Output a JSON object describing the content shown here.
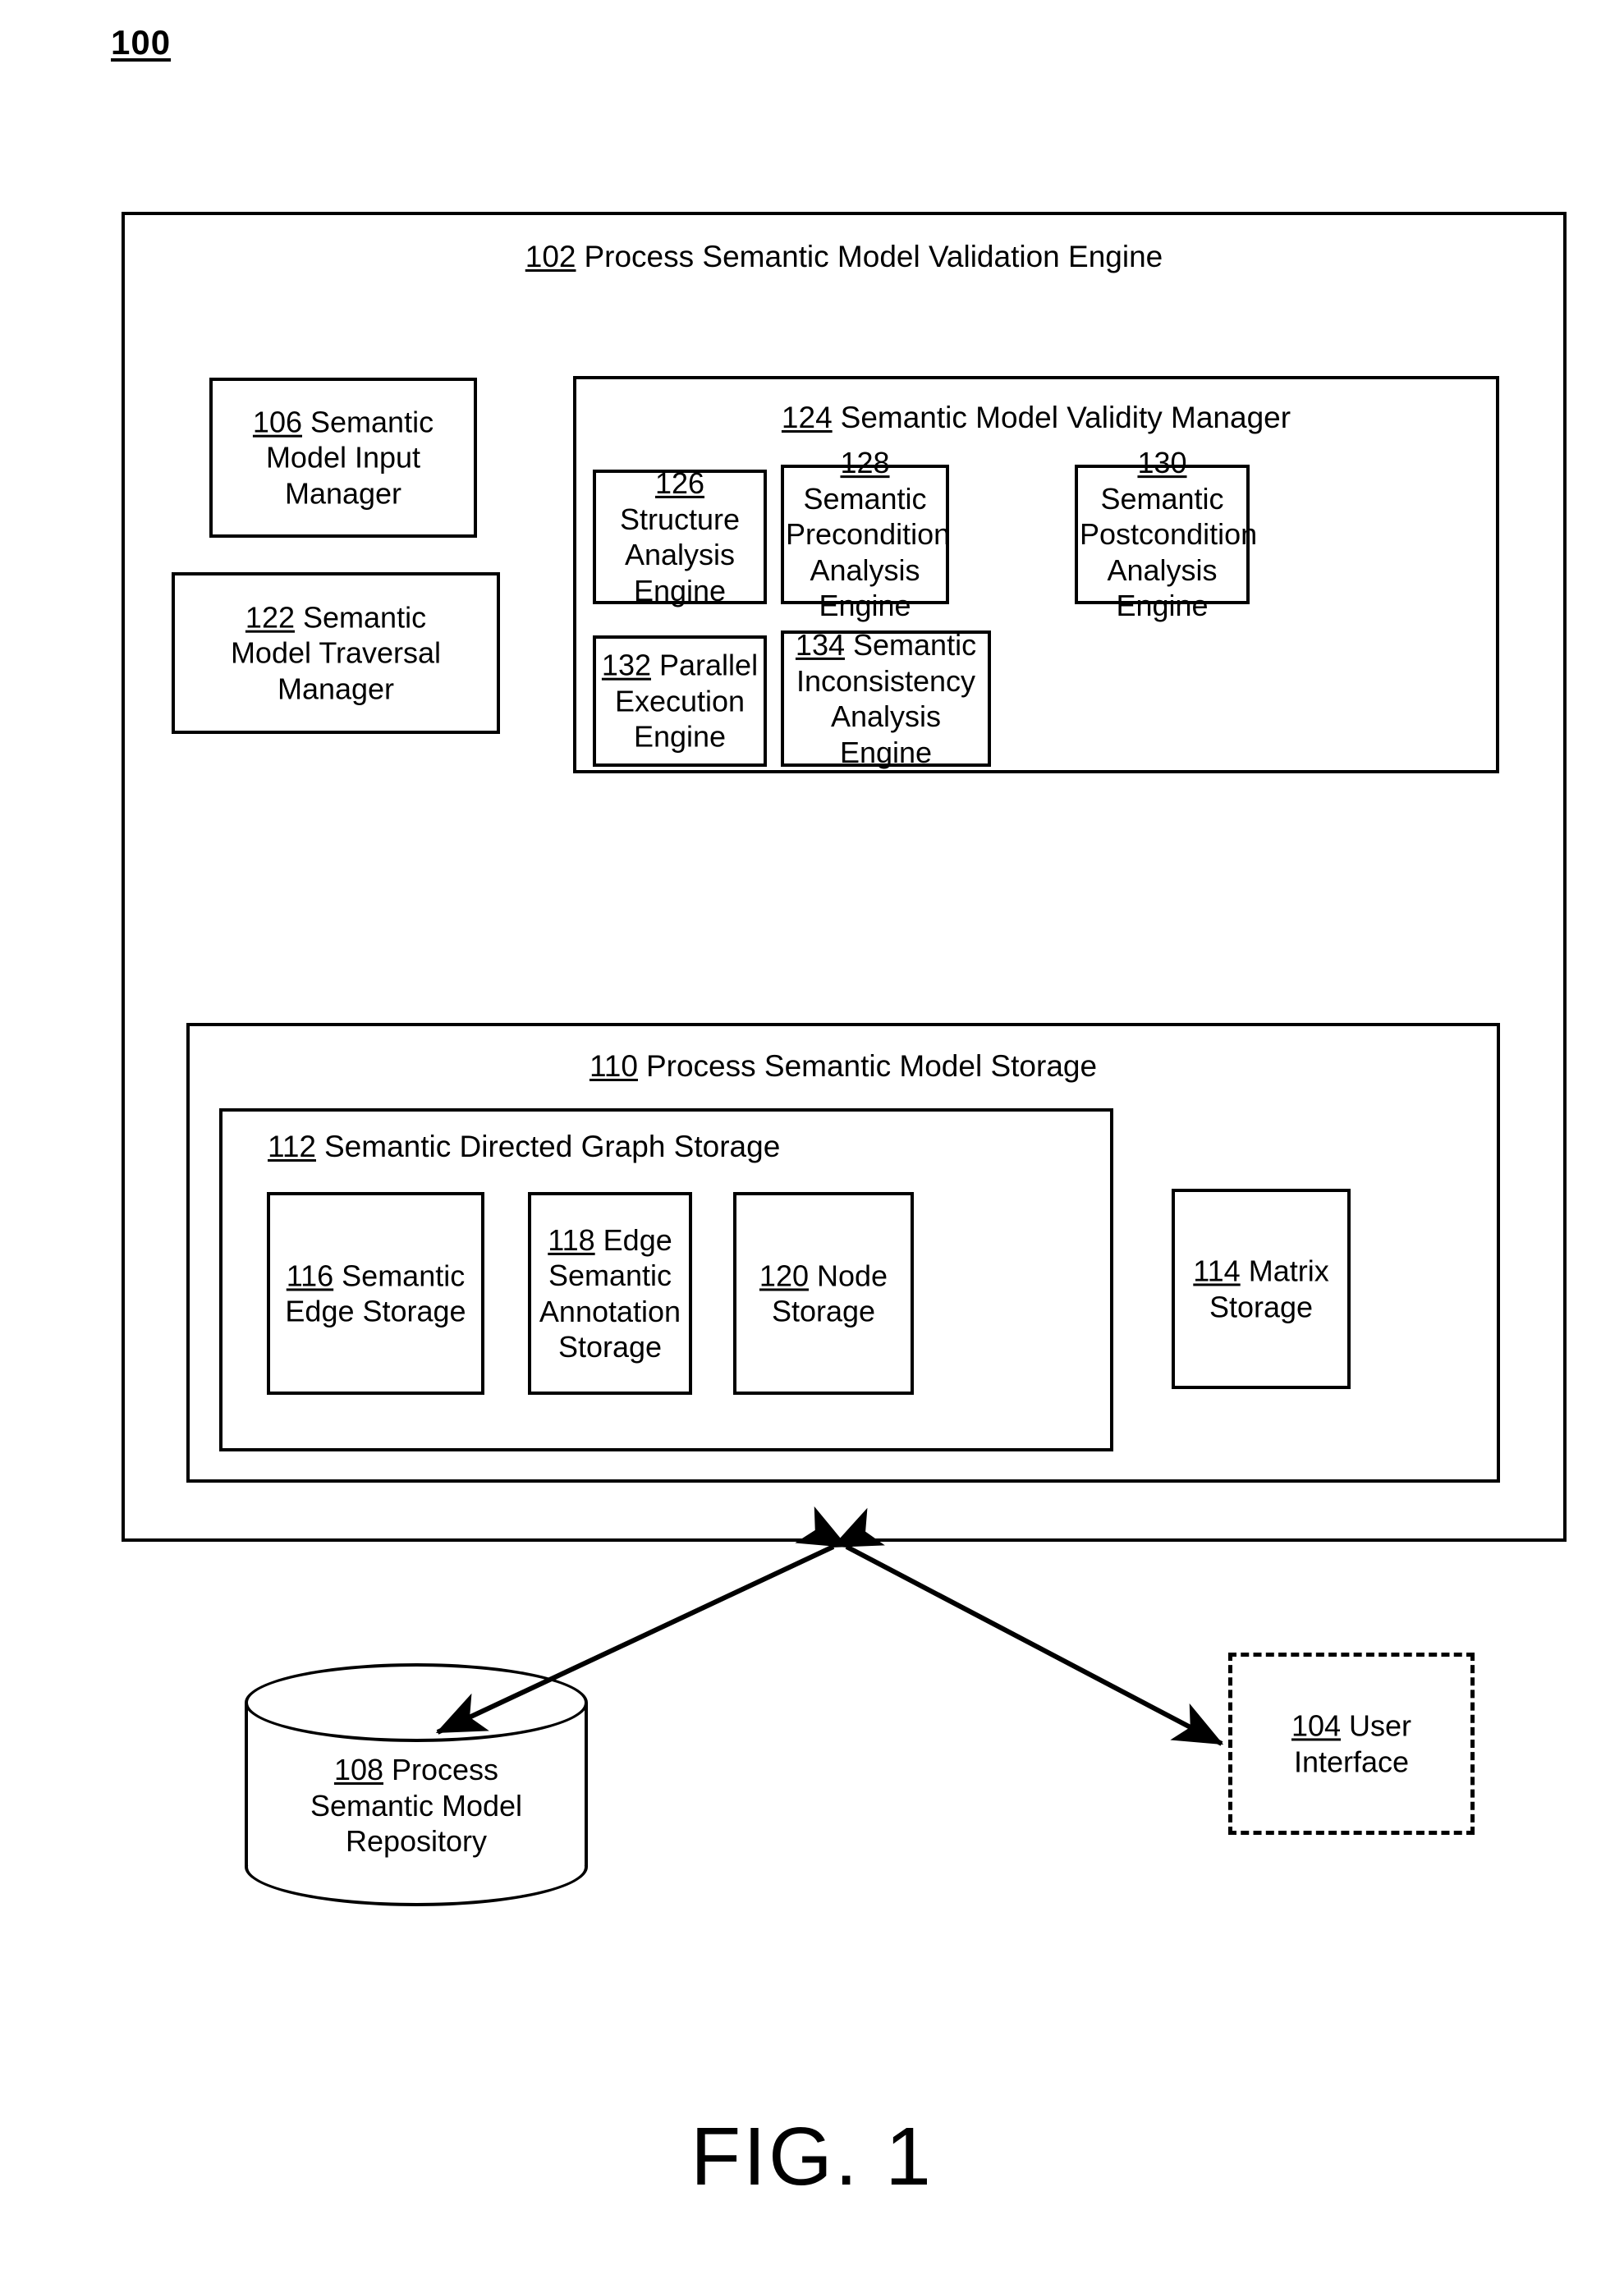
{
  "figure": {
    "number_label": "100",
    "caption": "FIG. 1"
  },
  "engine": {
    "ref": "102",
    "title": "Process Semantic Model Validation Engine",
    "input_manager": {
      "ref": "106",
      "line1": " Semantic",
      "line2": "Model Input",
      "line3": "Manager"
    },
    "traversal_manager": {
      "ref": "122",
      "line1": " Semantic",
      "line2": "Model Traversal",
      "line3": "Manager"
    },
    "validity_manager": {
      "ref": "124",
      "title": "Semantic Model Validity Manager",
      "structure_analysis": {
        "ref": "126",
        "line1": " Structure",
        "line2": "Analysis",
        "line3": "Engine"
      },
      "precondition_analysis": {
        "ref": "128",
        "line1": " Semantic",
        "line2": "Precondition",
        "line3": "Analysis",
        "line4": "Engine"
      },
      "postcondition_analysis": {
        "ref": "130",
        "line1": " Semantic",
        "line2": "Postcondition",
        "line3": "Analysis",
        "line4": "Engine"
      },
      "parallel_execution": {
        "ref": "132",
        "line1": " Parallel",
        "line2": "Execution",
        "line3": "Engine"
      },
      "inconsistency_analysis": {
        "ref": "134",
        "line1": " Semantic",
        "line2": "Inconsistency",
        "line3": "Analysis Engine"
      }
    },
    "model_storage": {
      "ref": "110",
      "title": "Process Semantic Model Storage",
      "graph_storage": {
        "ref": "112",
        "title": "Semantic Directed Graph Storage",
        "edge_storage": {
          "ref": "116",
          "line1": " Semantic",
          "line2": "Edge Storage"
        },
        "edge_annotation_storage": {
          "ref": "118",
          "line1": " Edge",
          "line2": "Semantic",
          "line3": "Annotation",
          "line4": "Storage"
        },
        "node_storage": {
          "ref": "120",
          "line1": " Node",
          "line2": "Storage"
        }
      },
      "matrix_storage": {
        "ref": "114",
        "line1": " Matrix",
        "line2": "Storage"
      }
    }
  },
  "repository": {
    "ref": "108",
    "line1": " Process",
    "line2": "Semantic Model",
    "line3": "Repository"
  },
  "user_interface": {
    "ref": "104",
    "line1": " User",
    "line2": "Interface"
  },
  "connectors": [
    {
      "name": "engine-to-repository",
      "from": "102 Process Semantic Model Validation Engine",
      "to": "108 Process Semantic Model Repository",
      "style": "double-headed-arrow"
    },
    {
      "name": "engine-to-user-interface",
      "from": "102 Process Semantic Model Validation Engine",
      "to": "104 User Interface",
      "style": "double-headed-arrow"
    }
  ],
  "colors": {
    "stroke": "#000000",
    "background": "#ffffff"
  }
}
